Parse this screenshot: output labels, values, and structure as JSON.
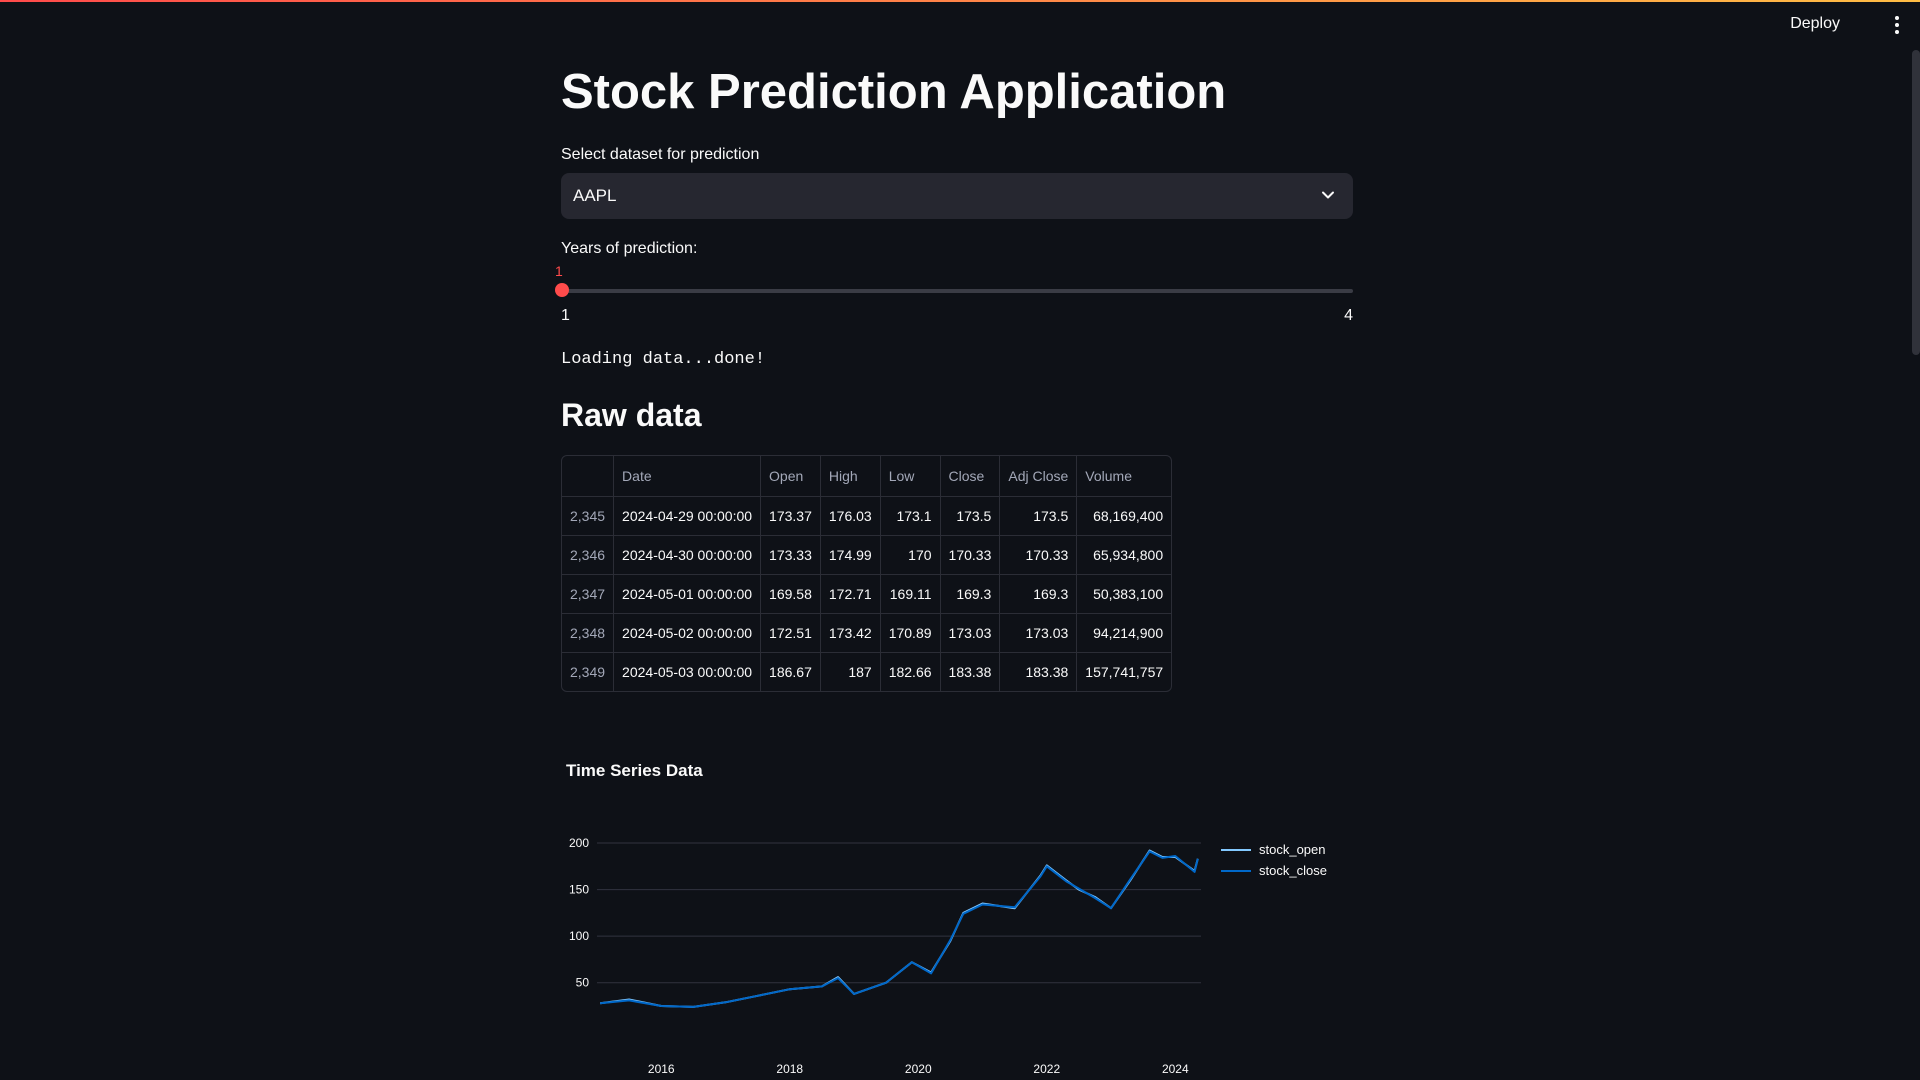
{
  "header": {
    "deploy_label": "Deploy"
  },
  "main": {
    "title": "Stock Prediction Application",
    "select_label": "Select dataset for prediction",
    "select_value": "AAPL",
    "slider_label": "Years of prediction:",
    "slider_value": "1",
    "slider_min": "1",
    "slider_max": "4",
    "slider_fraction": 0,
    "status": "Loading data...done!",
    "section_heading": "Raw data"
  },
  "table": {
    "columns": [
      "",
      "Date",
      "Open",
      "High",
      "Low",
      "Close",
      "Adj Close",
      "Volume"
    ],
    "rows": [
      [
        "2,345",
        "2024-04-29 00:00:00",
        "173.37",
        "176.03",
        "173.1",
        "173.5",
        "173.5",
        "68,169,400"
      ],
      [
        "2,346",
        "2024-04-30 00:00:00",
        "173.33",
        "174.99",
        "170",
        "170.33",
        "170.33",
        "65,934,800"
      ],
      [
        "2,347",
        "2024-05-01 00:00:00",
        "169.58",
        "172.71",
        "169.11",
        "169.3",
        "169.3",
        "50,383,100"
      ],
      [
        "2,348",
        "2024-05-02 00:00:00",
        "172.51",
        "173.42",
        "170.89",
        "173.03",
        "173.03",
        "94,214,900"
      ],
      [
        "2,349",
        "2024-05-03 00:00:00",
        "186.67",
        "187",
        "182.66",
        "183.38",
        "183.38",
        "157,741,757"
      ]
    ]
  },
  "chart_data": {
    "type": "line",
    "title": "Time Series Data",
    "xlabel": "",
    "ylabel": "",
    "x_ticks": [
      "2016",
      "2018",
      "2020",
      "2022",
      "2024"
    ],
    "y_ticks": [
      50,
      100,
      150,
      200
    ],
    "xlim": [
      2015.0,
      2024.4
    ],
    "ylim": [
      25,
      200
    ],
    "grid": true,
    "legend_position": "top-right",
    "series": [
      {
        "name": "stock_open",
        "color": "#83c9ff",
        "x": [
          2015.05,
          2015.5,
          2016.0,
          2016.5,
          2017.0,
          2017.5,
          2018.0,
          2018.5,
          2018.75,
          2019.0,
          2019.5,
          2019.9,
          2020.2,
          2020.5,
          2020.7,
          2021.0,
          2021.5,
          2021.9,
          2022.0,
          2022.3,
          2022.5,
          2022.75,
          2023.0,
          2023.3,
          2023.6,
          2023.8,
          2024.0,
          2024.3,
          2024.35
        ],
        "values": [
          28,
          32,
          25,
          24,
          29,
          36,
          43,
          46,
          56,
          38,
          50,
          72,
          61,
          95,
          125,
          135,
          130,
          165,
          176,
          160,
          150,
          142,
          130,
          160,
          192,
          185,
          185,
          170,
          183
        ]
      },
      {
        "name": "stock_close",
        "color": "#0068c9",
        "x": [
          2015.05,
          2015.5,
          2016.0,
          2016.5,
          2017.0,
          2017.5,
          2018.0,
          2018.5,
          2018.75,
          2019.0,
          2019.5,
          2019.9,
          2020.2,
          2020.5,
          2020.7,
          2021.0,
          2021.5,
          2021.9,
          2022.0,
          2022.3,
          2022.5,
          2022.75,
          2023.0,
          2023.3,
          2023.6,
          2023.8,
          2024.0,
          2024.3,
          2024.35
        ],
        "values": [
          28,
          31,
          25,
          24,
          29,
          36,
          43,
          46,
          55,
          38,
          50,
          72,
          60,
          96,
          124,
          134,
          131,
          164,
          175,
          159,
          151,
          141,
          130,
          161,
          191,
          184,
          186,
          169,
          183
        ]
      }
    ]
  }
}
